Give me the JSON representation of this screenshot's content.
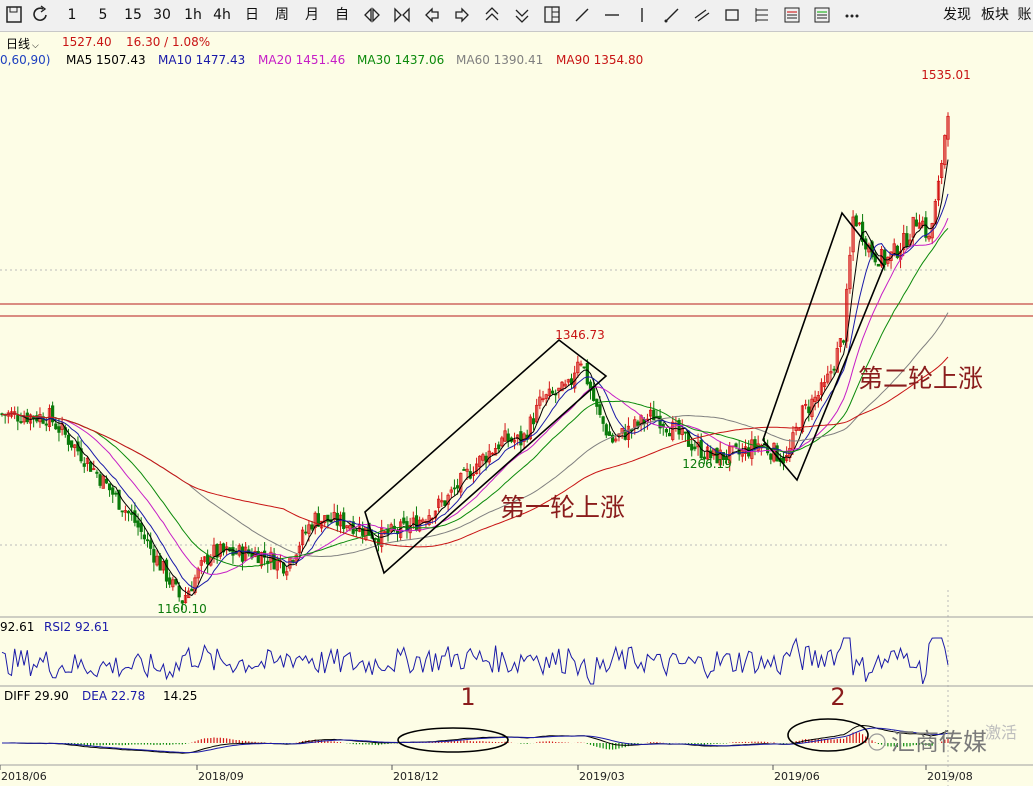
{
  "toolbar": {
    "periods": [
      "1",
      "5",
      "15",
      "30",
      "1h",
      "4h",
      "日",
      "周",
      "月",
      "自"
    ],
    "right": [
      "发现",
      "板块",
      "账"
    ]
  },
  "info": {
    "period": "日线",
    "price": "1527.40",
    "change": "16.30 / 1.08%"
  },
  "ma": [
    {
      "label": "0,60,90)",
      "color": "#1d3fbf"
    },
    {
      "label": "MA5 1507.43",
      "color": "#000000"
    },
    {
      "label": "MA10 1477.43",
      "color": "#1a1aa8"
    },
    {
      "label": "MA20 1451.46",
      "color": "#c61ec6"
    },
    {
      "label": "MA30 1437.06",
      "color": "#0b8a0b"
    },
    {
      "label": "MA60 1390.41",
      "color": "#808080"
    },
    {
      "label": "MA90 1354.80",
      "color": "#c81414"
    }
  ],
  "rsi": {
    "left": "92.61",
    "label": "RSI2 92.61"
  },
  "macd": {
    "diff": "DIFF 29.90",
    "dea": "DEA 22.78",
    "hist": "14.25"
  },
  "chart_data": {
    "type": "candlestick",
    "title": "",
    "x_ticks": [
      "2018/06",
      "2018/09",
      "2018/12",
      "2019/03",
      "2019/06",
      "2019/08"
    ],
    "annotations": {
      "high1": "1346.73",
      "low1": "1160.10",
      "low2": "1266.19",
      "high2": "1535.01",
      "wave1": "第一轮上涨",
      "wave2": "第二轮上涨",
      "mark1": "1",
      "mark2": "2"
    },
    "key_points": [
      {
        "date": "2018/06",
        "close": 1300
      },
      {
        "date": "2018/08",
        "close": 1160.1
      },
      {
        "date": "2018/12",
        "close": 1240
      },
      {
        "date": "2019/02",
        "close": 1346.73
      },
      {
        "date": "2019/05",
        "close": 1266.19
      },
      {
        "date": "2019/06",
        "close": 1440
      },
      {
        "date": "2019/08",
        "close": 1535.01
      }
    ],
    "horizontal_lines": [
      1440,
      1432
    ],
    "series": [
      "MA5",
      "MA10",
      "MA20",
      "MA30",
      "MA60",
      "MA90"
    ]
  },
  "watermark": {
    "text": "汇商传媒",
    "side": "激活"
  }
}
